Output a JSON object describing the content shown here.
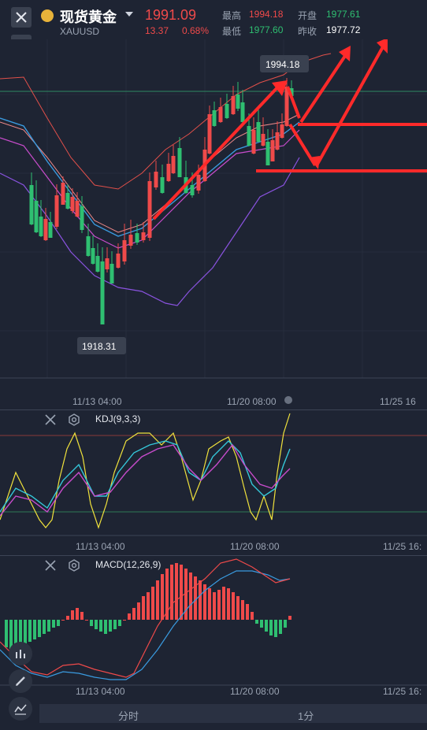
{
  "header": {
    "symbol_name": "现货黄金",
    "symbol_code": "XAUUSD",
    "price": "1991.09",
    "change": "13.37",
    "change_pct": "0.68%",
    "high_label": "最高",
    "high_value": "1994.18",
    "open_label": "开盘",
    "open_value": "1977.61",
    "low_label": "最低",
    "low_value": "1977.60",
    "prev_close_label": "昨收",
    "prev_close_value": "1977.72"
  },
  "main_chart": {
    "high_marker": "1994.18",
    "low_marker": "1918.31",
    "time_labels": [
      "11/13 04:00",
      "11/20 08:00",
      "11/25 16"
    ]
  },
  "kdj": {
    "title": "KDJ(9,3,3)",
    "time_labels": [
      "11/13 04:00",
      "11/20 08:00",
      "11/25 16:"
    ]
  },
  "macd": {
    "title": "MACD(12,26,9)",
    "time_labels": [
      "11/13 04:00",
      "11/20 08:00",
      "11/25 16:"
    ]
  },
  "bottom": {
    "tf1": "分时",
    "tf2": "1分"
  },
  "colors": {
    "up": "#ef4a4a",
    "down": "#2fbf71",
    "annotation": "#ff2a2a",
    "k_line": "#f0e23c",
    "d_line": "#35c7d9",
    "j_line": "#c84ccc"
  },
  "icons": [
    "close-icon",
    "gold-coin-icon",
    "collapse-icon",
    "gear-icon",
    "pencil-icon",
    "indicator-icon"
  ]
}
